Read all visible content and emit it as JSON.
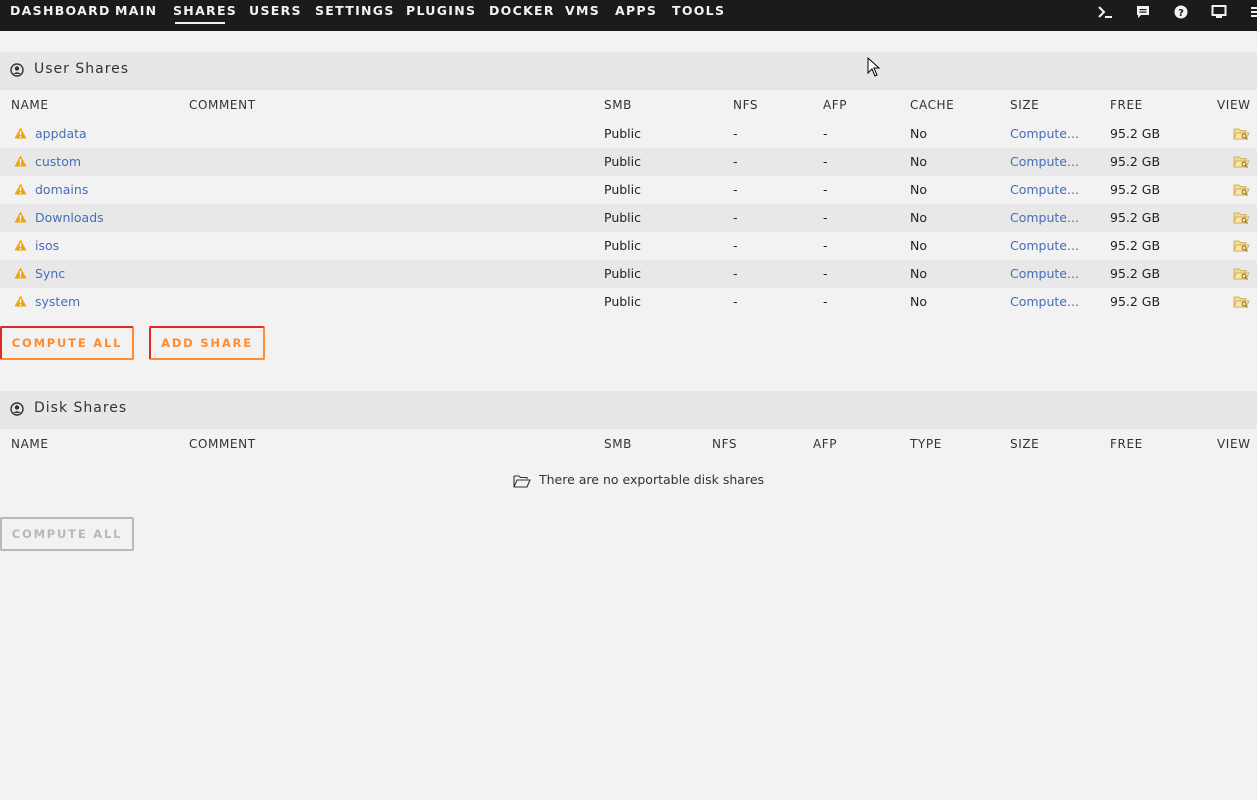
{
  "nav": {
    "items": [
      "DASHBOARD",
      "MAIN",
      "SHARES",
      "USERS",
      "SETTINGS",
      "PLUGINS",
      "DOCKER",
      "VMS",
      "APPS",
      "TOOLS"
    ],
    "active": "SHARES",
    "icons": [
      "terminal-icon",
      "feedback-icon",
      "help-icon",
      "monitor-icon",
      "menu-icon"
    ]
  },
  "user_shares": {
    "title": "User Shares",
    "columns": [
      "NAME",
      "COMMENT",
      "SMB",
      "NFS",
      "AFP",
      "CACHE",
      "SIZE",
      "FREE",
      "VIEW"
    ],
    "rows": [
      {
        "name": "appdata",
        "comment": "",
        "smb": "Public",
        "nfs": "-",
        "afp": "-",
        "cache": "No",
        "size": "Compute...",
        "free": "95.2 GB"
      },
      {
        "name": "custom",
        "comment": "",
        "smb": "Public",
        "nfs": "-",
        "afp": "-",
        "cache": "No",
        "size": "Compute...",
        "free": "95.2 GB"
      },
      {
        "name": "domains",
        "comment": "",
        "smb": "Public",
        "nfs": "-",
        "afp": "-",
        "cache": "No",
        "size": "Compute...",
        "free": "95.2 GB"
      },
      {
        "name": "Downloads",
        "comment": "",
        "smb": "Public",
        "nfs": "-",
        "afp": "-",
        "cache": "No",
        "size": "Compute...",
        "free": "95.2 GB"
      },
      {
        "name": "isos",
        "comment": "",
        "smb": "Public",
        "nfs": "-",
        "afp": "-",
        "cache": "No",
        "size": "Compute...",
        "free": "95.2 GB"
      },
      {
        "name": "Sync",
        "comment": "",
        "smb": "Public",
        "nfs": "-",
        "afp": "-",
        "cache": "No",
        "size": "Compute...",
        "free": "95.2 GB"
      },
      {
        "name": "system",
        "comment": "",
        "smb": "Public",
        "nfs": "-",
        "afp": "-",
        "cache": "No",
        "size": "Compute...",
        "free": "95.2 GB"
      }
    ],
    "compute_all_label": "COMPUTE ALL",
    "add_share_label": "ADD SHARE"
  },
  "disk_shares": {
    "title": "Disk Shares",
    "columns": [
      "NAME",
      "COMMENT",
      "SMB",
      "NFS",
      "AFP",
      "TYPE",
      "SIZE",
      "FREE",
      "VIEW"
    ],
    "empty_message": "There are no exportable disk shares",
    "compute_all_label": "COMPUTE ALL"
  },
  "colors": {
    "nav_bg": "#1c1b1b",
    "link": "#486dba",
    "warning": "#f0a30a",
    "button_accent": "#ff8c2f",
    "button_border": "#e22828"
  }
}
